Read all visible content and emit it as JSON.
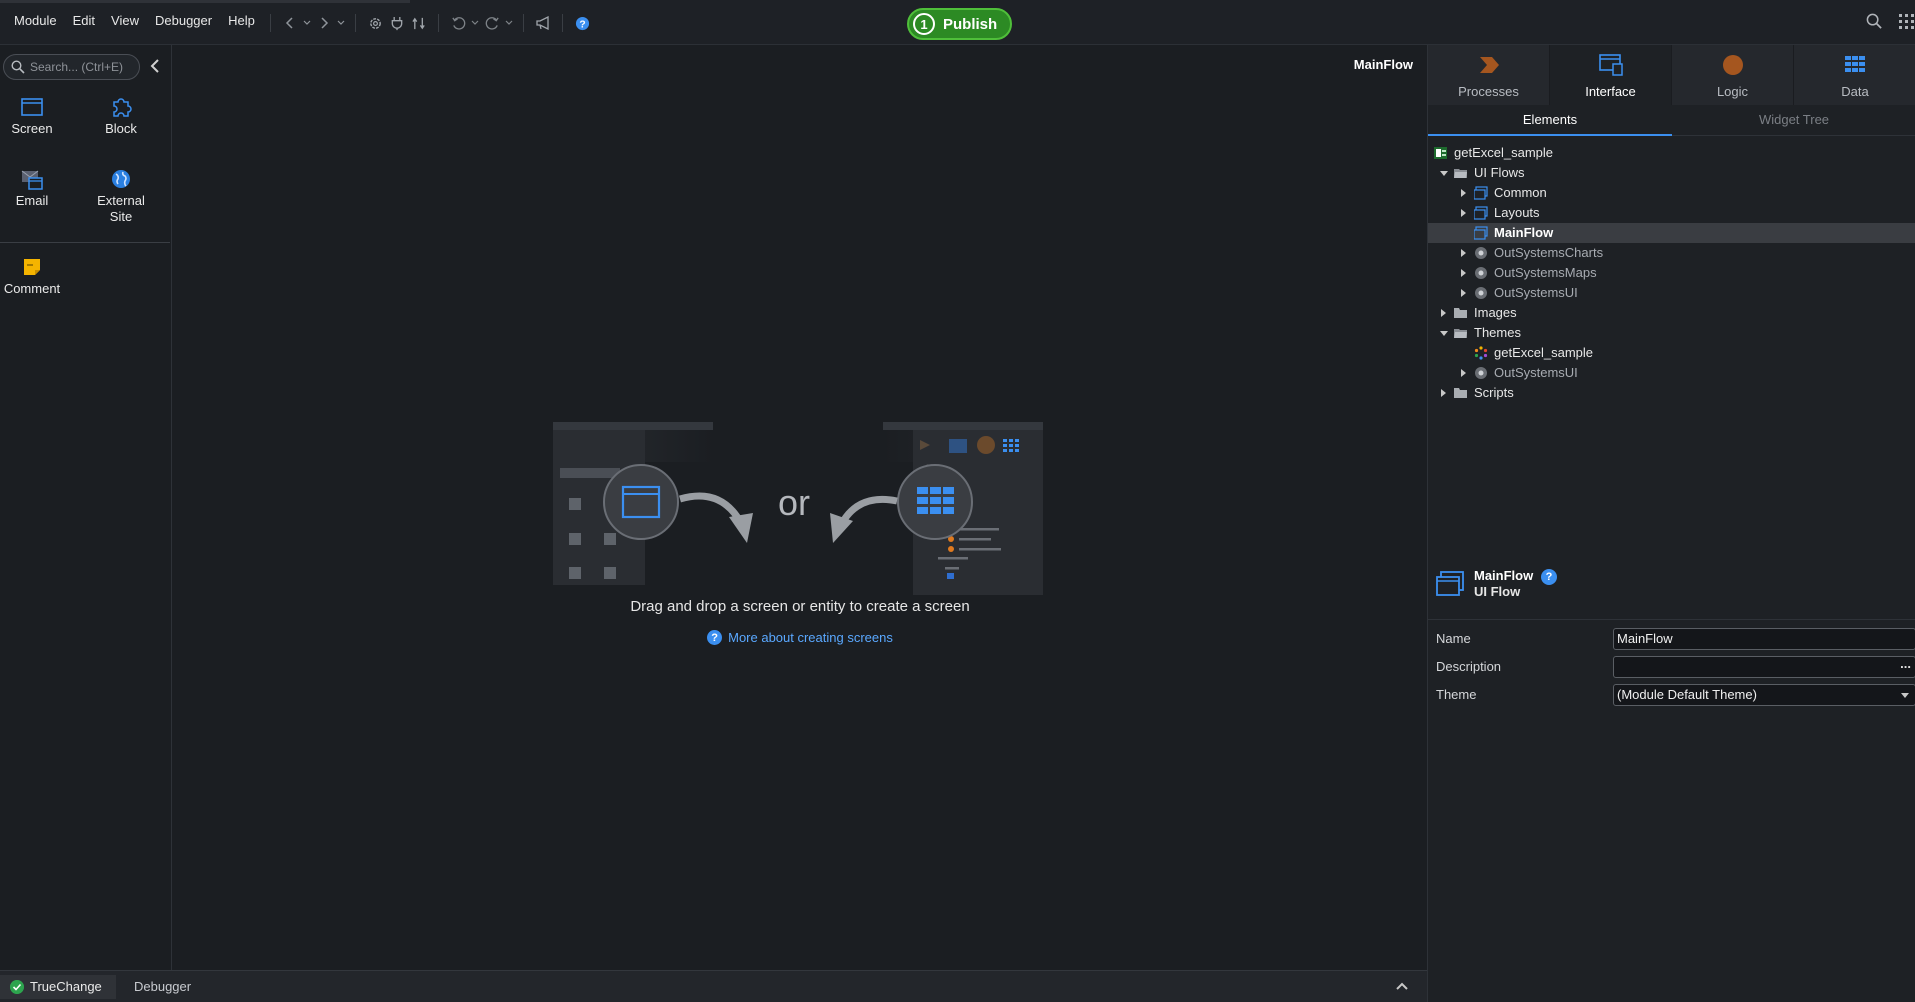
{
  "menu": [
    "Module",
    "Edit",
    "View",
    "Debugger",
    "Help"
  ],
  "toolbar": {
    "icons": [
      "back-icon",
      "forward-icon",
      "settings-icon",
      "plug-icon",
      "compare-icon",
      "undo-icon",
      "redo-icon",
      "megaphone-icon",
      "help-icon"
    ],
    "publish_count": "1",
    "publish_label": "Publish",
    "accent": "#2c8a24"
  },
  "toolbox": {
    "search_placeholder": "Search... (Ctrl+E)",
    "items": {
      "screen": "Screen",
      "block": "Block",
      "email": "Email",
      "external_site_line1": "External",
      "external_site_line2": "Site",
      "comment": "Comment"
    }
  },
  "canvas": {
    "flow_name": "MainFlow",
    "or_text": "or",
    "drag_text": "Drag and drop a screen or entity to create a screen",
    "more_link": "More about creating screens",
    "more_icon": "?"
  },
  "right_panel": {
    "tabs": [
      "Processes",
      "Interface",
      "Logic",
      "Data"
    ],
    "active_tab": "Interface",
    "sub_tabs": [
      "Elements",
      "Widget Tree"
    ],
    "tree": [
      "getExcel_sample",
      "UI Flows",
      "Common",
      "Layouts",
      "MainFlow",
      "OutSystemsCharts",
      "OutSystemsMaps",
      "OutSystemsUI",
      "Images",
      "Themes",
      "getExcel_sample",
      "OutSystemsUI",
      "Scripts"
    ],
    "props": {
      "title": "MainFlow",
      "subtitle": "UI Flow",
      "help": "?",
      "name_label": "Name",
      "name_value": "MainFlow",
      "description_label": "Description",
      "description_value": "",
      "description_more": "...",
      "theme_label": "Theme",
      "theme_value": "(Module Default Theme)"
    }
  },
  "bottom": {
    "truechange": "TrueChange",
    "debugger": "Debugger"
  }
}
